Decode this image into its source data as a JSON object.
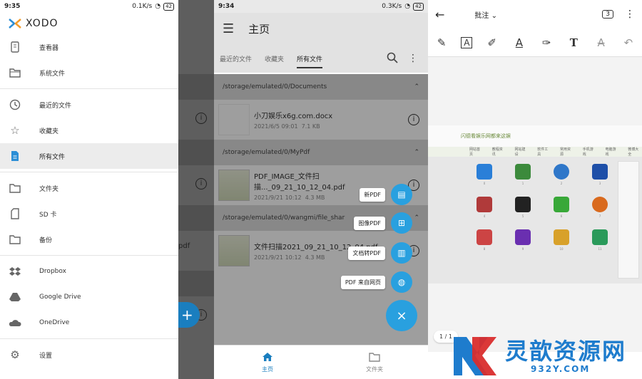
{
  "panel1": {
    "status": {
      "time": "9:35",
      "net": "0.1K/s",
      "battery": "42"
    },
    "brand": "XODO",
    "items": [
      {
        "label": "查看器",
        "icon": "phone-icon"
      },
      {
        "label": "系统文件",
        "icon": "folder-open-icon"
      },
      {
        "label": "最近的文件",
        "icon": "clock-icon"
      },
      {
        "label": "收藏夹",
        "icon": "star-icon"
      },
      {
        "label": "所有文件",
        "icon": "document-icon",
        "active": true
      },
      {
        "label": "文件夹",
        "icon": "folder-icon"
      },
      {
        "label": "SD 卡",
        "icon": "sd-card-icon"
      },
      {
        "label": "备份",
        "icon": "folder-icon"
      },
      {
        "label": "Dropbox",
        "icon": "dropbox-icon"
      },
      {
        "label": "Google Drive",
        "icon": "google-drive-icon"
      },
      {
        "label": "OneDrive",
        "icon": "onedrive-icon"
      },
      {
        "label": "设置",
        "icon": "gear-icon"
      }
    ],
    "behind": {
      "pdf": "pdf",
      "fab": "+"
    }
  },
  "panel2": {
    "status": {
      "time": "9:34",
      "net": "0.3K/s",
      "battery": "42"
    },
    "title": "主页",
    "tabs": [
      "最近的文件",
      "收藏夹",
      "所有文件"
    ],
    "sections": [
      {
        "path": "/storage/emulated/0/Documents",
        "files": [
          {
            "name": "小刀娱乐x6g.com.docx",
            "date": "2021/6/5 09:01",
            "size": "7.1 KB"
          }
        ]
      },
      {
        "path": "/storage/emulated/0/MyPdf",
        "files": [
          {
            "name": "PDF_IMAGE_文件扫描..._09_21_10_12_04.pdf",
            "date": "2021/9/21 10:12",
            "size": "4.3 MB"
          }
        ]
      },
      {
        "path": "/storage/emulated/0/wangmi/file_shar",
        "files": [
          {
            "name": "文件扫描2021_09_21_10_12_04.pdf",
            "date": "2021/9/21 10:12",
            "size": "4.3 MB"
          }
        ]
      }
    ],
    "speed_dial": [
      "新PDF",
      "图像PDF",
      "文档转PDF",
      "PDF 来自网页"
    ],
    "close": "×",
    "bottom_nav": [
      "主页",
      "文件夹"
    ]
  },
  "panel3": {
    "title": "批注",
    "page_count": "3",
    "page_indicator": "1 / 1",
    "doc_header": "闪德看娱乐网都来这娱",
    "doc_menu": [
      "网站首页",
      "教程资讯",
      "网站建设",
      "软件工具",
      "常用资源",
      "手机游戏",
      "电脑游戏",
      "微博大全"
    ],
    "tiles": [
      "0",
      "1",
      "2",
      "3",
      "4",
      "5",
      "6",
      "7",
      "8",
      "9",
      "10",
      "11"
    ],
    "watermark_cn": "灵歆资源网",
    "watermark_url": "932Y.COM"
  }
}
